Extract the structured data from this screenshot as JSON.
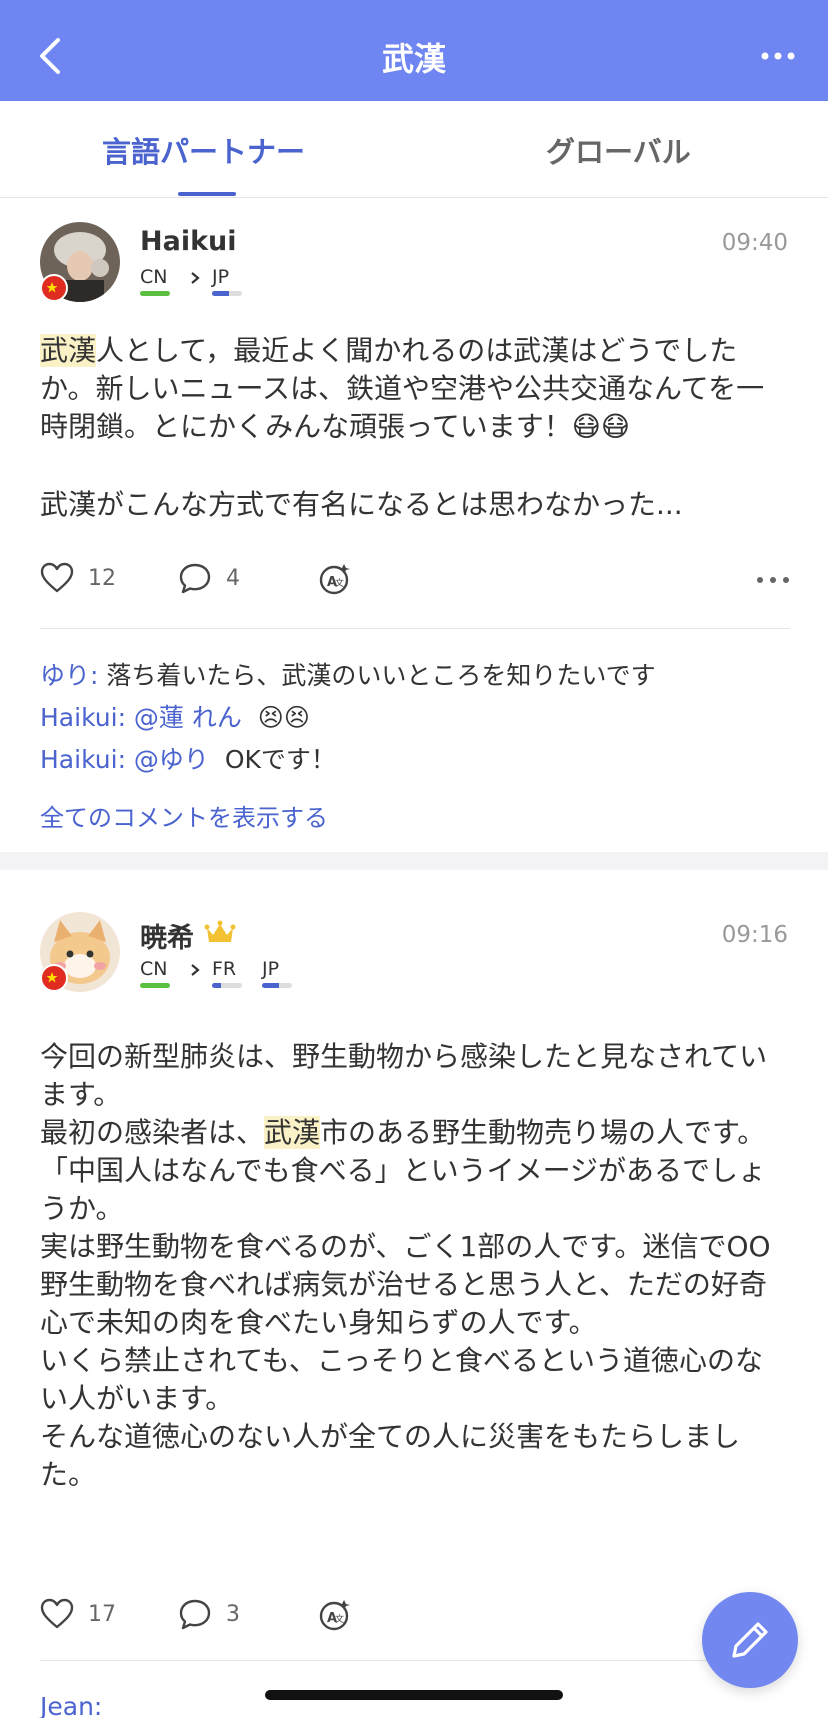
{
  "header": {
    "title": "武漢"
  },
  "tabs": [
    {
      "label": "言語パートナー",
      "active": true
    },
    {
      "label": "グローバル",
      "active": false
    }
  ],
  "posts": [
    {
      "username": "Haikui",
      "time": "09:40",
      "languages": [
        {
          "code": "CN",
          "level": 1.0,
          "color": "#5bbf3f"
        },
        {
          "code": "JP",
          "level": 0.55,
          "color": "#4a63cf"
        }
      ],
      "body_highlight": "武漢",
      "body_rest": "人として，最近よく聞かれるのは武漢はどうでしたか。新しいニュースは、鉄道や空港や公共交通なんてを一時閉鎖。とにかくみんな頑張っています！😷😷",
      "body_para2": "武漢がこんな方式で有名になるとは思わなかった...",
      "likes": "12",
      "comments_count": "4",
      "comments": [
        {
          "name": "ゆり:",
          "text": " 落ち着いたら、武漢のいいところを知りたいです"
        },
        {
          "name": "Haikui: @蓮 れん",
          "text": "  😣😣"
        },
        {
          "name": "Haikui: @ゆり",
          "text": "  OKです！"
        }
      ],
      "show_all": "全てのコメントを表示する"
    },
    {
      "username": "暁希",
      "time": "09:16",
      "languages": [
        {
          "code": "CN",
          "level": 1.0,
          "color": "#5bbf3f"
        },
        {
          "code": "FR",
          "level": 0.3,
          "color": "#4a63cf"
        },
        {
          "code": "JP",
          "level": 0.55,
          "color": "#4a63cf"
        }
      ],
      "body_line1": "今回の新型肺炎は、野生動物から感染したと見なされています。",
      "body_line2a": "最初の感染者は、",
      "body_highlight": "武漢",
      "body_line2b": "市のある野生動物売り場の人です。",
      "body_rest": "「中国人はなんでも食べる」というイメージがあるでしょうか。\n実は野生動物を食べるのが、ごく1部の人です。迷信でOO野生動物を食べれば病気が治せると思う人と、ただの好奇心で未知の肉を食べたい身知らずの人です。\nいくら禁止されても、こっそりと食べるという道徳心のない人がいます。\nそんな道徳心のない人が全ての人に災害をもたらしました。",
      "likes": "17",
      "comments_count": "3",
      "peek_comment": "Jean:"
    }
  ],
  "colors": {
    "accent": "#6f86f2",
    "link": "#4a63cf",
    "highlight": "#fbf1c7"
  }
}
